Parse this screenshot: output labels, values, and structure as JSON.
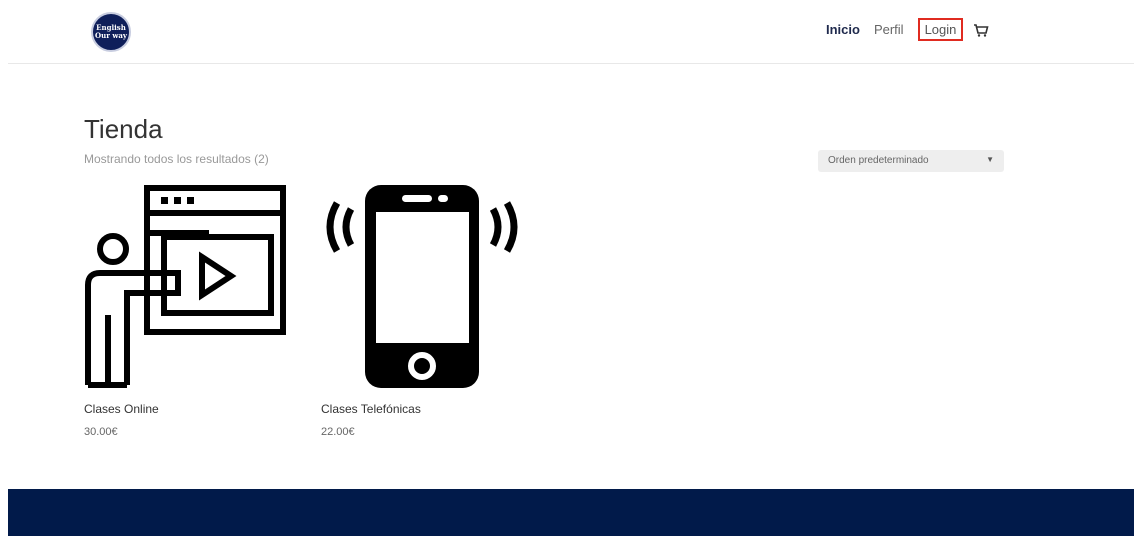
{
  "header": {
    "logo_text": [
      "English",
      "Our way"
    ],
    "nav": {
      "inicio": "Inicio",
      "perfil": "Perfil",
      "login": "Login"
    }
  },
  "shop": {
    "title": "Tienda",
    "result_count": "Mostrando todos los resultados (2)",
    "orderby_selected": "Orden predeterminado"
  },
  "products": [
    {
      "name": "Clases Online",
      "price": "30.00€",
      "icon": "teacher-presentation-icon"
    },
    {
      "name": "Clases Telefónicas",
      "price": "22.00€",
      "icon": "phone-ringing-icon"
    }
  ],
  "colors": {
    "footer": "#011a4a",
    "logo": "#0f1f5a",
    "login_highlight": "#e02b20"
  }
}
